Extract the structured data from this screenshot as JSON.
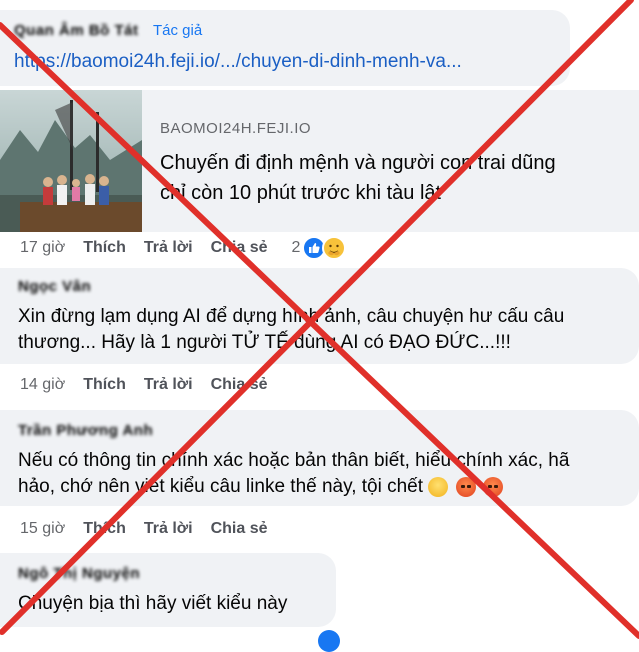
{
  "post": {
    "author": "Quan Âm Bồ Tát",
    "author_tag": "Tác giả",
    "link": "https://baomoi24h.feji.io/.../chuyen-di-dinh-menh-va...",
    "preview": {
      "domain": "BAOMOI24H.FEJI.IO",
      "title_line1": "Chuyến đi định mệnh và người con trai dũng",
      "title_line2": "chỉ còn 10 phút trước khi tàu lật"
    },
    "actions": {
      "time": "17 giờ",
      "like": "Thích",
      "reply": "Trả lời",
      "share": "Chia sẻ",
      "reaction_count": "2"
    }
  },
  "comments": [
    {
      "author": "Ngọc Vân",
      "line1": "Xin đừng lạm dụng AI để dựng hình ảnh, câu chuyện hư cấu câu",
      "line2": "thương... Hãy là 1 người TỬ TẾ dùng AI có ĐẠO ĐỨC...!!!",
      "actions": {
        "time": "14 giờ",
        "like": "Thích",
        "reply": "Trả lời",
        "share": "Chia sẻ"
      }
    },
    {
      "author": "Trần Phương Anh",
      "line1": "Nếu có thông tin chính xác hoặc bản thân biết, hiểu chính xác, hã",
      "line2": "hảo, chớ nên viết kiểu câu linke thế này, tội chết",
      "actions": {
        "time": "15 giờ",
        "like": "Thích",
        "reply": "Trả lời",
        "share": "Chia sẻ"
      }
    },
    {
      "author": "Ngô Thị Nguyện",
      "line1": "Chuyện bịa thì hãy viết kiểu này"
    }
  ],
  "colors": {
    "link": "#1b5fc4",
    "cross": "#e0302a",
    "bubble": "#f0f2f5",
    "meta": "#65676b"
  }
}
